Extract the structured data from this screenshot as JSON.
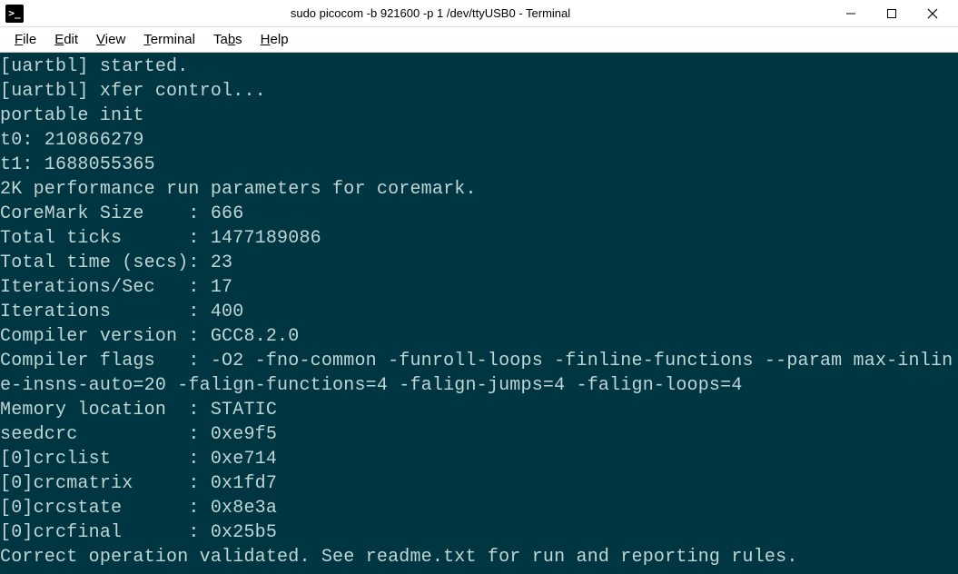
{
  "titlebar": {
    "icon_text": ">_",
    "title": "sudo picocom -b 921600 -p 1 /dev/ttyUSB0 - Terminal"
  },
  "menubar": {
    "items": [
      {
        "label": "File",
        "underline_index": 0
      },
      {
        "label": "Edit",
        "underline_index": 0
      },
      {
        "label": "View",
        "underline_index": 0
      },
      {
        "label": "Terminal",
        "underline_index": 0
      },
      {
        "label": "Tabs",
        "underline_index": 2
      },
      {
        "label": "Help",
        "underline_index": 0
      }
    ]
  },
  "terminal": {
    "lines": [
      "[uartbl] started.",
      "[uartbl] xfer control...",
      "portable init",
      "t0: 210866279",
      "t1: 1688055365",
      "2K performance run parameters for coremark.",
      "CoreMark Size    : 666",
      "Total ticks      : 1477189086",
      "Total time (secs): 23",
      "Iterations/Sec   : 17",
      "Iterations       : 400",
      "Compiler version : GCC8.2.0",
      "Compiler flags   : -O2 -fno-common -funroll-loops -finline-functions --param max-inline-insns-auto=20 -falign-functions=4 -falign-jumps=4 -falign-loops=4",
      "Memory location  : STATIC",
      "seedcrc          : 0xe9f5",
      "[0]crclist       : 0xe714",
      "[0]crcmatrix     : 0x1fd7",
      "[0]crcstate      : 0x8e3a",
      "[0]crcfinal      : 0x25b5",
      "Correct operation validated. See readme.txt for run and reporting rules."
    ]
  }
}
